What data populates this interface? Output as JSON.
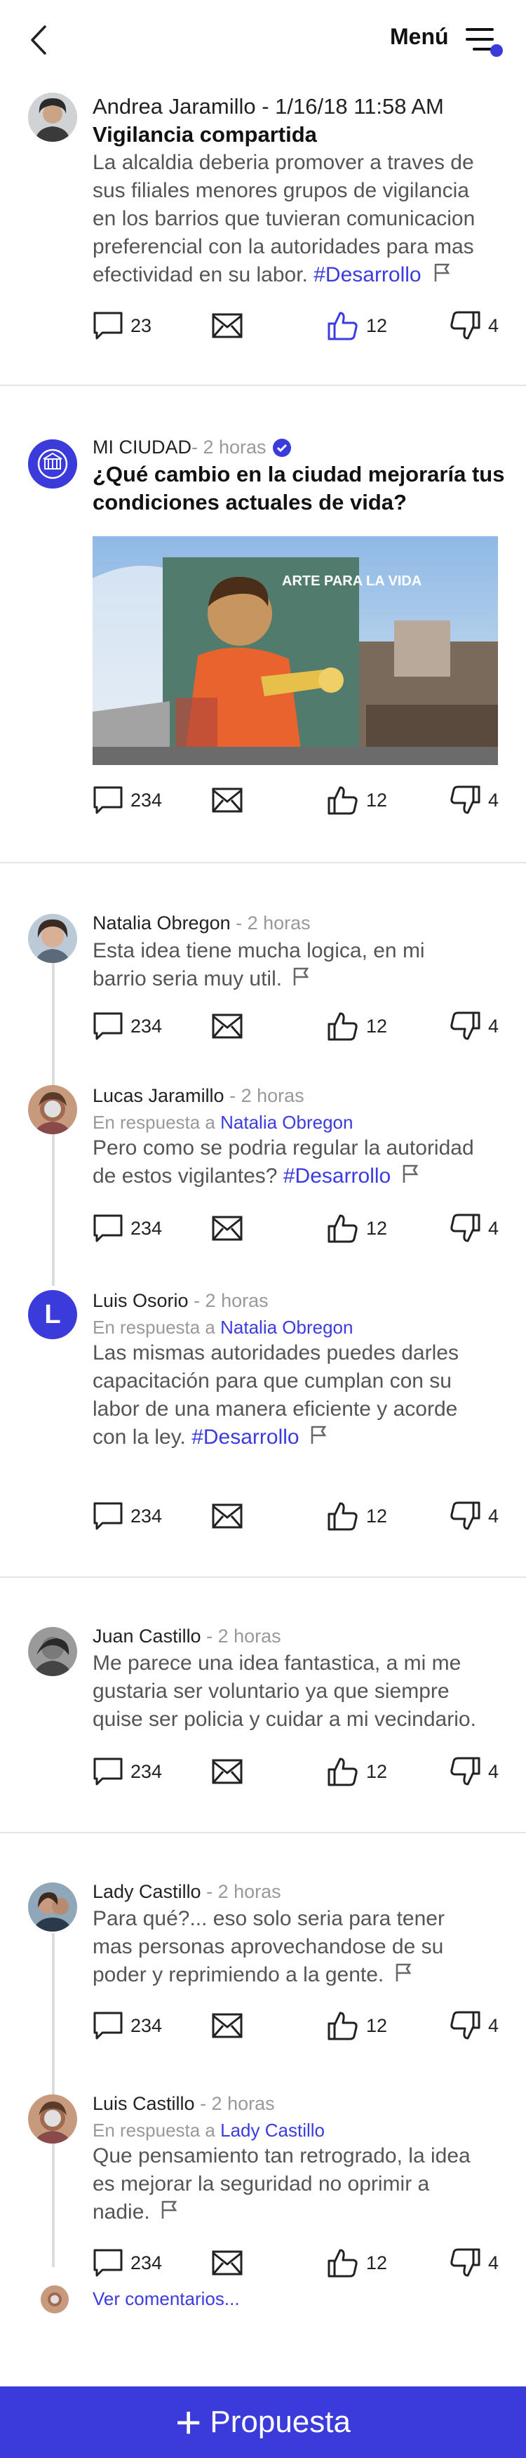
{
  "header": {
    "menu_label": "Menú"
  },
  "post1": {
    "author_line": "Andrea Jaramillo - 1/16/18 11:58 AM",
    "title": "Vigilancia compartida",
    "body_lines": [
      "La alcaldia deberia promover a traves de",
      "sus filiales menores grupos de vigilancia",
      "en los barrios que tuvieran comunicacion",
      "preferencial con la autoridades para mas",
      "efectividad en su labor."
    ],
    "tag": "#Desarrollo",
    "comments": "23",
    "likes": "12",
    "dislikes": "4"
  },
  "post2": {
    "author": "MI CIUDAD",
    "time": " - 2 horas",
    "title_lines": [
      "¿Qué cambio en la ciudad mejoraría tus",
      "condiciones actuales de vida?"
    ],
    "image_text": "ARTE PARA LA VIDA",
    "comments": "234",
    "likes": "12",
    "dislikes": "4"
  },
  "thread1": [
    {
      "author": "Natalia Obregon",
      "time": " - 2 horas",
      "body_lines": [
        "Esta idea tiene mucha logica, en mi",
        "barrio seria muy util."
      ],
      "comments": "234",
      "likes": "12",
      "dislikes": "4"
    },
    {
      "author": "Lucas Jaramillo",
      "time": " - 2 horas",
      "reply_prefix": "En respuesta a ",
      "reply_to": "Natalia Obregon",
      "body_lines": [
        "Pero como se podria regular la autoridad",
        "de estos vigilantes?"
      ],
      "tag": "#Desarrollo",
      "comments": "234",
      "likes": "12",
      "dislikes": "4"
    },
    {
      "author": "Luis Osorio",
      "initial": "L",
      "time": " - 2 horas",
      "reply_prefix": "En respuesta a ",
      "reply_to": "Natalia Obregon",
      "body_lines": [
        "Las mismas autoridades puedes darles",
        "capacitación para que cumplan con su",
        "labor de una manera eficiente y acorde",
        "con la ley."
      ],
      "tag": "#Desarrollo",
      "comments": "234",
      "likes": "12",
      "dislikes": "4"
    }
  ],
  "thread2": [
    {
      "author": "Juan Castillo",
      "time": " - 2 horas",
      "body_lines": [
        "Me parece una idea fantastica, a mi me",
        "gustaria ser voluntario ya que siempre",
        "quise ser policia y cuidar a mi vecindario."
      ],
      "comments": "234",
      "likes": "12",
      "dislikes": "4"
    }
  ],
  "thread3": [
    {
      "author": "Lady Castillo",
      "time": " - 2 horas",
      "body_lines": [
        "Para qué?... eso solo seria para tener",
        "mas personas aprovechandose de su",
        "poder y reprimiendo a la gente."
      ],
      "comments": "234",
      "likes": "12",
      "dislikes": "4"
    },
    {
      "author": "Luis Castillo",
      "time": " - 2 horas",
      "reply_prefix": "En respuesta a ",
      "reply_to": "Lady Castillo",
      "body_lines": [
        "Que pensamiento tan retrogrado, la idea",
        "es mejorar la seguridad no oprimir a",
        "nadie."
      ],
      "comments": "234",
      "likes": "12",
      "dislikes": "4"
    }
  ],
  "more_comments": "Ver comentarios...",
  "bottom_button": {
    "plus": "+",
    "label": "Propuesta"
  },
  "colors": {
    "accent": "#3b3bdb",
    "link": "#3b3be0"
  }
}
